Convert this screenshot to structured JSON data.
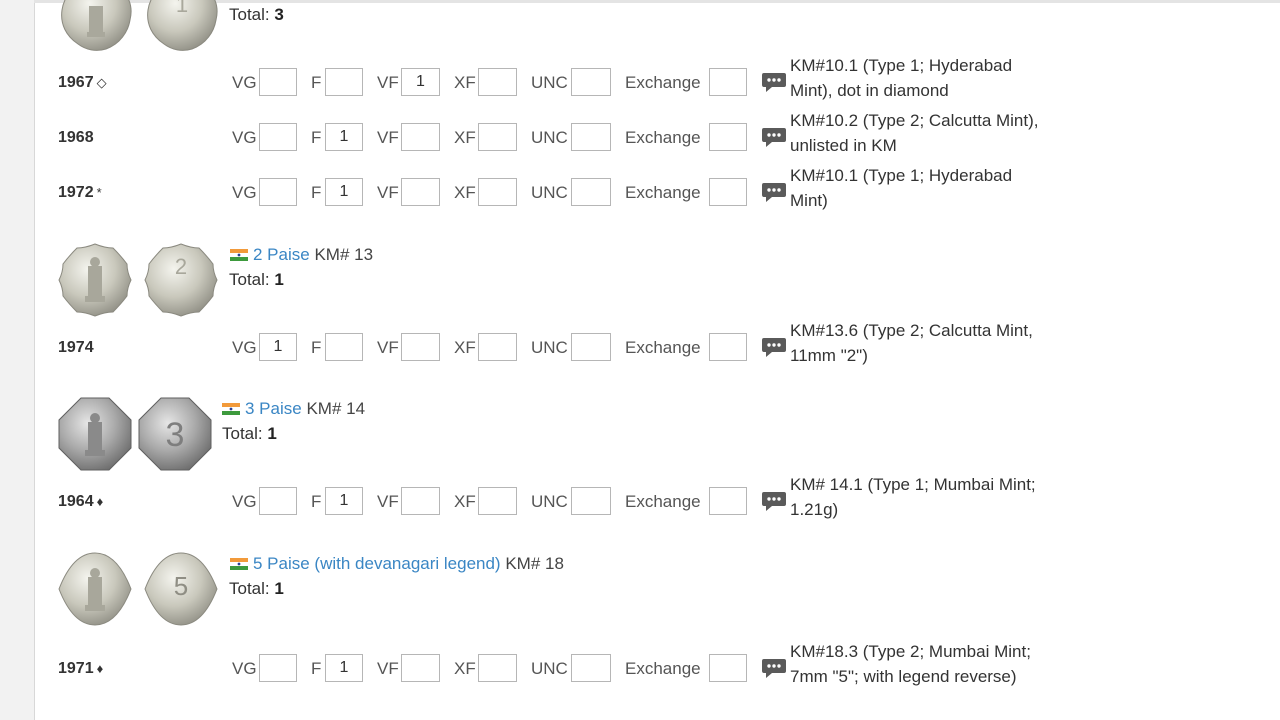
{
  "colors": {
    "link": "#3a86c4",
    "text": "#333333",
    "box_border": "#b6b6b6"
  },
  "icons": {
    "comment": "comment-bubble-icon",
    "flag": "india-flag-icon",
    "diamond": "diamond-outline-icon"
  },
  "grade_labels": {
    "vg": "VG",
    "f": "F",
    "vf": "VF",
    "xf": "XF",
    "unc": "UNC",
    "exchange": "Exchange"
  },
  "coin_1_paise": {
    "total_label": "Total:",
    "total": "3"
  },
  "coin_2_paise": {
    "name": "2 Paise",
    "km": "KM# 13",
    "total_label": "Total:",
    "total": "1"
  },
  "coin_3_paise": {
    "name": "3 Paise",
    "km": "KM# 14",
    "total_label": "Total:",
    "total": "1"
  },
  "coin_5_paise": {
    "name": "5 Paise (with devanagari legend)",
    "km": "KM# 18",
    "total_label": "Total:",
    "total": "1"
  },
  "rows": [
    {
      "year": "1967",
      "mark": "◇",
      "vg": "",
      "f": "",
      "vf": "1",
      "xf": "",
      "unc": "",
      "exchange": "",
      "note": "KM#10.1 (Type 1; Hyderabad Mint), dot in diamond"
    },
    {
      "year": "1968",
      "mark": "",
      "vg": "",
      "f": "1",
      "vf": "",
      "xf": "",
      "unc": "",
      "exchange": "",
      "note": "KM#10.2 (Type 2; Calcutta Mint), unlisted in KM"
    },
    {
      "year": "1972",
      "mark": "*",
      "vg": "",
      "f": "1",
      "vf": "",
      "xf": "",
      "unc": "",
      "exchange": "",
      "note": "KM#10.1 (Type 1; Hyderabad Mint)"
    },
    {
      "year": "1974",
      "mark": "",
      "vg": "1",
      "f": "",
      "vf": "",
      "xf": "",
      "unc": "",
      "exchange": "",
      "note": "KM#13.6 (Type 2; Calcutta Mint, 11mm \"2\")"
    },
    {
      "year": "1964",
      "mark": "♦",
      "vg": "",
      "f": "1",
      "vf": "",
      "xf": "",
      "unc": "",
      "exchange": "",
      "note": "KM# 14.1 (Type 1; Mumbai Mint; 1.21g)"
    },
    {
      "year": "1971",
      "mark": "♦",
      "vg": "",
      "f": "1",
      "vf": "",
      "xf": "",
      "unc": "",
      "exchange": "",
      "note": "KM#18.3 (Type 2; Mumbai Mint; 7mm \"5\"; with legend reverse)"
    }
  ]
}
